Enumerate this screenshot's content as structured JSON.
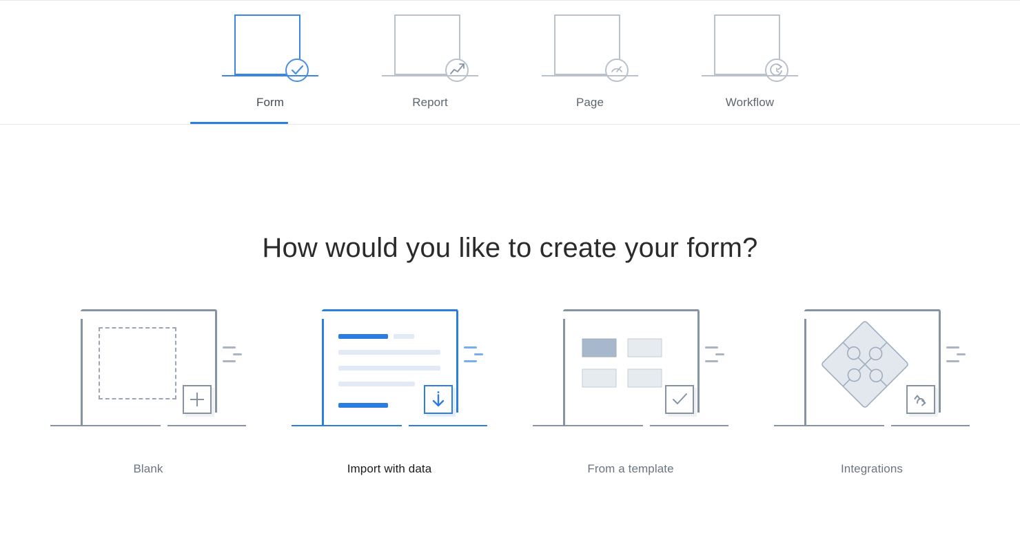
{
  "app": {
    "heading": "How would you like to create your form?"
  },
  "type_tabs": {
    "active": "Form",
    "items": [
      {
        "id": "form",
        "label": "Form",
        "icon": "form-thumbnail-icon",
        "active": true
      },
      {
        "id": "report",
        "label": "Report",
        "icon": "report-thumbnail-icon",
        "active": false
      },
      {
        "id": "page",
        "label": "Page",
        "icon": "page-thumbnail-icon",
        "active": false
      },
      {
        "id": "workflow",
        "label": "Workflow",
        "icon": "workflow-thumbnail-icon",
        "active": false
      }
    ]
  },
  "creation_options": {
    "selected": "Import with data",
    "items": [
      {
        "id": "blank",
        "label": "Blank",
        "badge_icon": "plus-icon",
        "selected": false
      },
      {
        "id": "import",
        "label": "Import with data",
        "badge_icon": "download-icon",
        "selected": true
      },
      {
        "id": "template",
        "label": "From a template",
        "badge_icon": "check-icon",
        "selected": false
      },
      {
        "id": "integrations",
        "label": "Integrations",
        "badge_icon": "sync-icon",
        "selected": false
      }
    ]
  },
  "colors": {
    "accent_blue": "#2b7de0",
    "accent_blue_light": "#4a90e2",
    "muted_slate": "#8693a5",
    "pale_blue": "#dbe7f8",
    "label_gray": "#6b7480",
    "label_dark": "#1a1a1a",
    "divider": "#e6e8eb"
  }
}
